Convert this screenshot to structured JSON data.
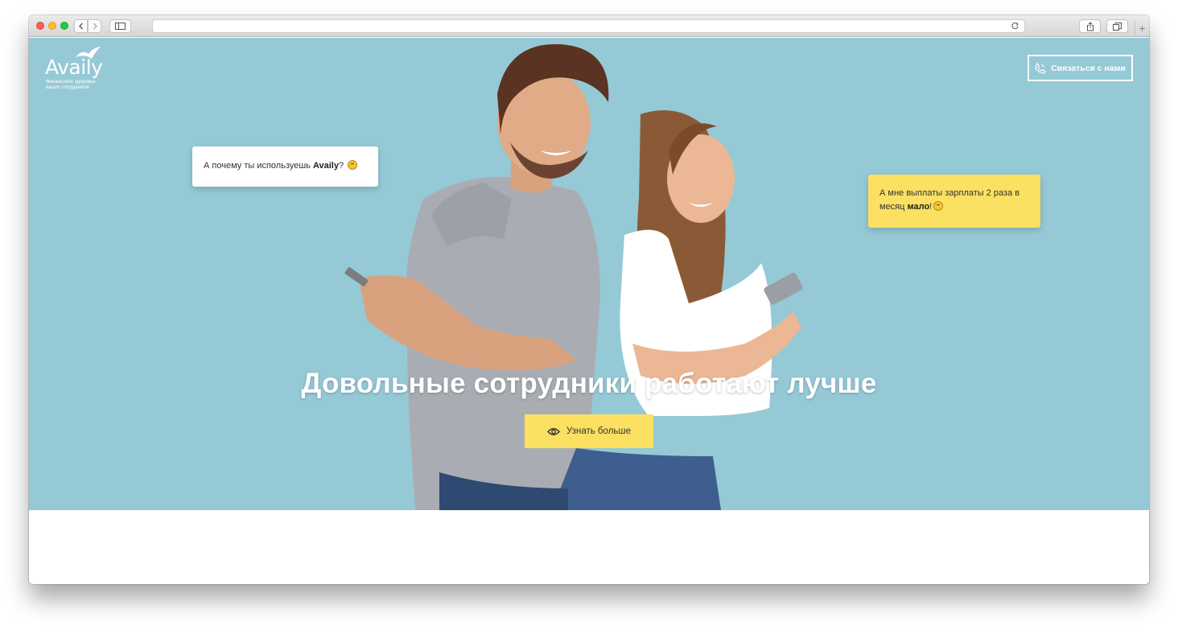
{
  "browser": {
    "address": "",
    "icons": [
      "back-icon",
      "forward-icon",
      "sidebar-icon",
      "reload-icon",
      "share-icon",
      "tabs-icon",
      "plus-icon"
    ],
    "new_tab_label": "+"
  },
  "header": {
    "logo_text": "Availy",
    "logo_tagline": "Финансовое здоровье ваших сотрудников",
    "contact_label": "Связаться с нами"
  },
  "bubbles": {
    "left_prefix": "А почему ты используешь ",
    "left_bold": "Availy",
    "left_suffix": "?",
    "right_prefix": "А мне выплаты зарплаты 2 раза в месяц ",
    "right_bold": "мало",
    "right_suffix": "!"
  },
  "hero": {
    "headline": "Довольные сотрудники работают лучше",
    "cta_label": "Узнать больше"
  },
  "colors": {
    "hero_bg": "#95c9d6",
    "accent_yellow": "#fbe062",
    "white": "#ffffff"
  }
}
